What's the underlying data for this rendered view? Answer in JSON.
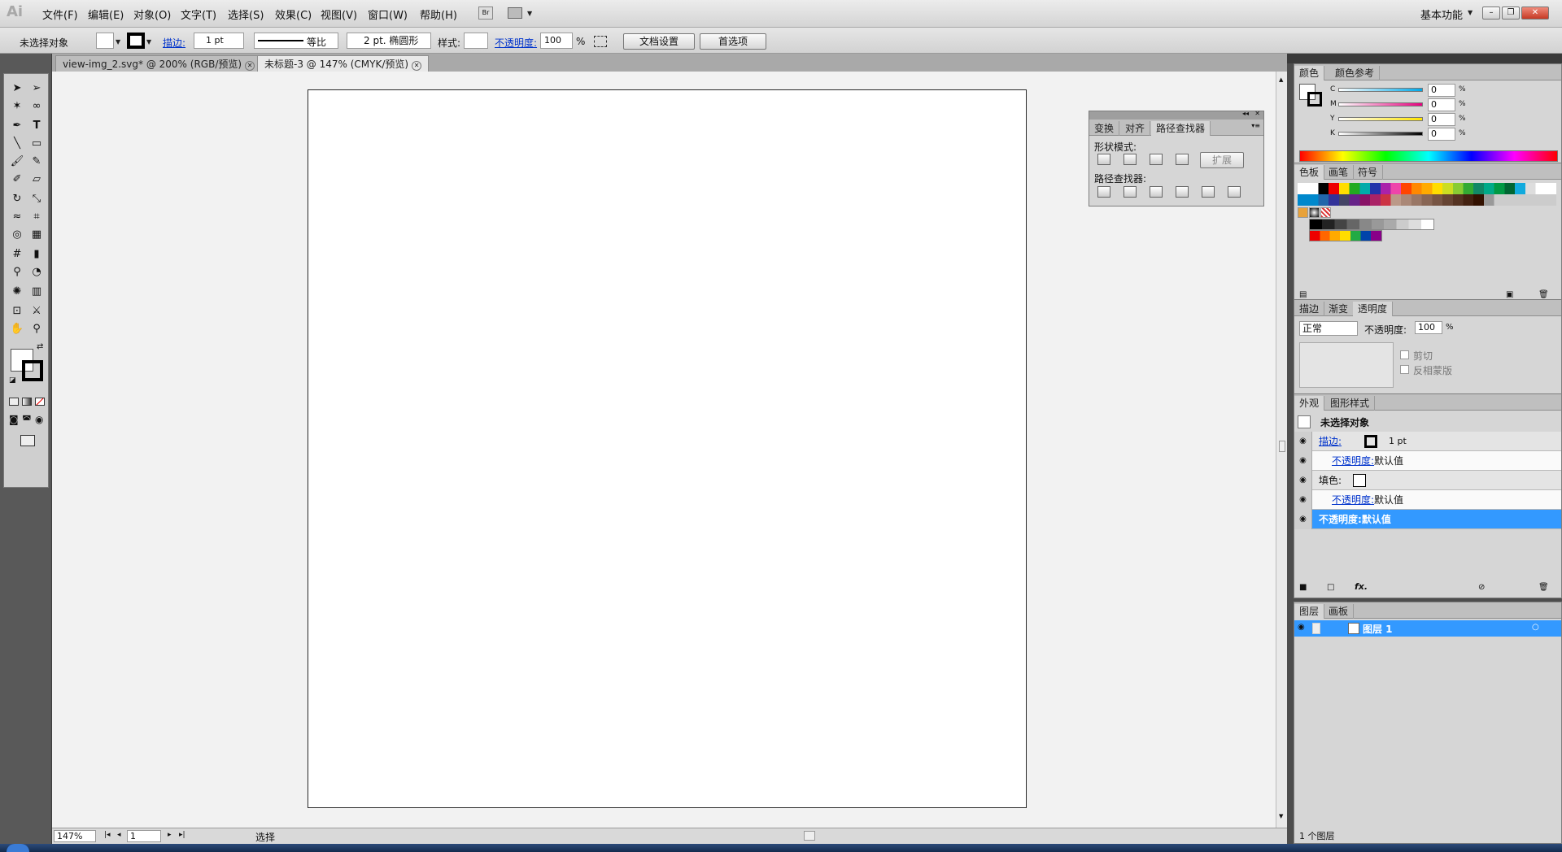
{
  "app": {
    "logo": "Ai",
    "workspace": "基本功能",
    "bridge": "Br"
  },
  "menu": [
    "文件(F)",
    "编辑(E)",
    "对象(O)",
    "文字(T)",
    "选择(S)",
    "效果(C)",
    "视图(V)",
    "窗口(W)",
    "帮助(H)"
  ],
  "control": {
    "selection": "未选择对象",
    "stroke_label": "描边:",
    "stroke_weight": "1 pt",
    "stroke_profile": "等比",
    "brush": "2 pt. 椭圆形",
    "style_label": "样式:",
    "opacity_label": "不透明度:",
    "opacity_value": "100",
    "opacity_unit": "%",
    "doc_setup": "文档设置",
    "prefs": "首选项"
  },
  "doc_tabs": [
    {
      "title": "view-img_2.svg* @ 200% (RGB/预览)"
    },
    {
      "title": "未标题-3 @ 147% (CMYK/预览)"
    }
  ],
  "status": {
    "zoom": "147%",
    "page": "1",
    "tool": "选择"
  },
  "pathfinder": {
    "tabs": [
      "变换",
      "对齐",
      "路径查找器"
    ],
    "shape_modes": "形状模式:",
    "expand": "扩展",
    "pathfinders": "路径查找器:"
  },
  "color_panel": {
    "tabs": [
      "颜色",
      "颜色参考"
    ],
    "channels": [
      {
        "name": "C",
        "value": "0",
        "unit": "%"
      },
      {
        "name": "M",
        "value": "0",
        "unit": "%"
      },
      {
        "name": "Y",
        "value": "0",
        "unit": "%"
      },
      {
        "name": "K",
        "value": "0",
        "unit": "%"
      }
    ]
  },
  "swatches_panel": {
    "tabs": [
      "色板",
      "画笔",
      "符号"
    ]
  },
  "transparency_panel": {
    "tabs": [
      "描边",
      "渐变",
      "透明度"
    ],
    "blend": "正常",
    "opacity_label": "不透明度:",
    "opacity_value": "100",
    "opacity_unit": "%",
    "clip": "剪切",
    "invert": "反相蒙版"
  },
  "appearance_panel": {
    "tabs": [
      "外观",
      "图形样式"
    ],
    "title": "未选择对象",
    "stroke_label": "描边:",
    "stroke_value": "1 pt",
    "opacity_label": "不透明度:",
    "default_value": "默认值",
    "fill_label": "填色:",
    "fx": "fx."
  },
  "layers_panel": {
    "tabs": [
      "图层",
      "画板"
    ],
    "layer_name": "图层 1",
    "count": "1 个图层"
  },
  "colors": {
    "selection": "#3399ff",
    "link": "#0033cc"
  }
}
